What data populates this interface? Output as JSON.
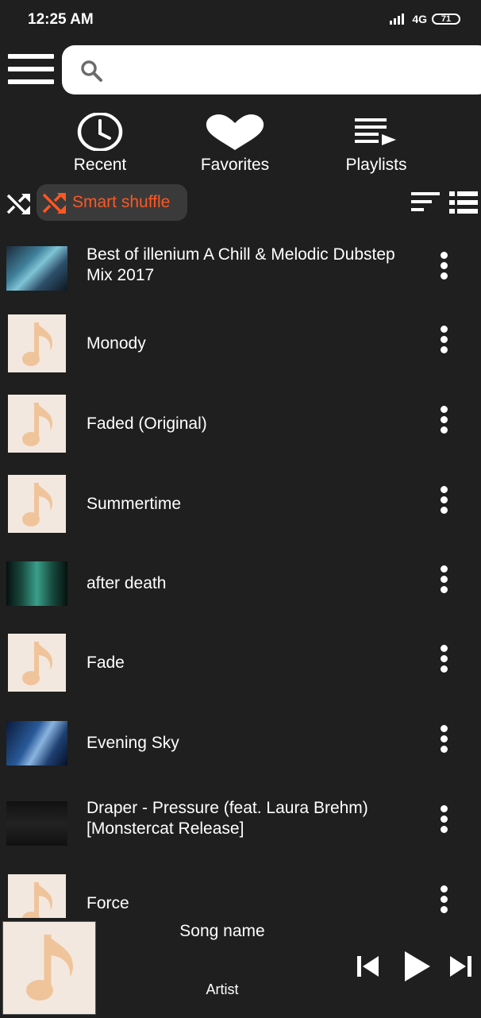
{
  "status_bar": {
    "time": "12:25 AM",
    "network": "4G",
    "battery": "71"
  },
  "search": {
    "placeholder": ""
  },
  "tabs": [
    {
      "label": "Recent",
      "icon": "clock-icon"
    },
    {
      "label": "Favorites",
      "icon": "heart-icon"
    },
    {
      "label": "Playlists",
      "icon": "playlist-icon"
    }
  ],
  "toolbar": {
    "smart_shuffle_label": "Smart shuffle"
  },
  "songs": [
    {
      "title": "Best of illenium   A Chill & Melodic Dubstep Mix 2017",
      "thumb": "video"
    },
    {
      "title": "Monody",
      "thumb": "music-note"
    },
    {
      "title": "Faded (Original)",
      "thumb": "music-note"
    },
    {
      "title": "Summertime",
      "thumb": "music-note"
    },
    {
      "title": "after death",
      "thumb": "video"
    },
    {
      "title": "Fade",
      "thumb": "music-note"
    },
    {
      "title": "Evening Sky",
      "thumb": "video"
    },
    {
      "title": "Draper - Pressure (feat. Laura Brehm) [Monstercat Release]",
      "thumb": "video"
    },
    {
      "title": "Force",
      "thumb": "music-note"
    }
  ],
  "now_playing": {
    "song": "Song name",
    "artist": "Artist"
  },
  "colors": {
    "background": "#1f1f1f",
    "accent": "#ff5722",
    "note": "#f0c49b",
    "thumb_bg": "#f3e8df"
  }
}
